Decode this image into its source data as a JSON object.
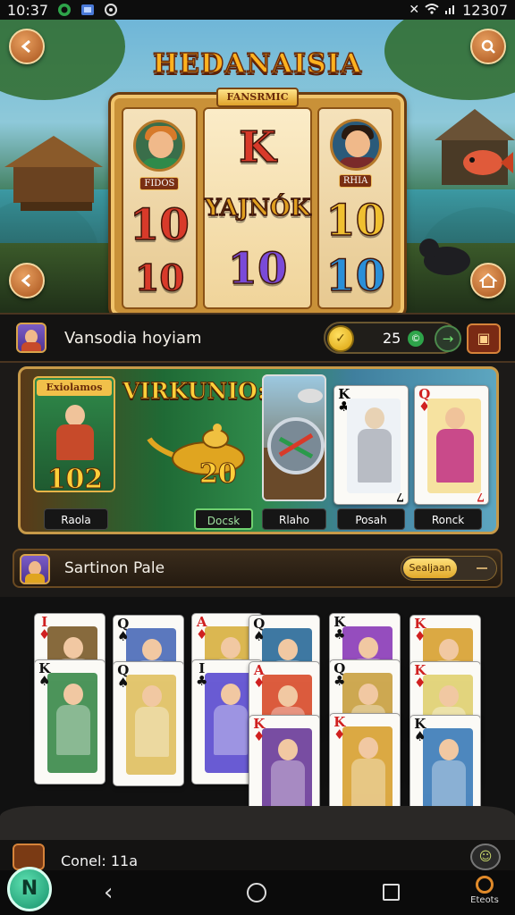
{
  "status_bar": {
    "time": "10:37",
    "clock_right": "12307"
  },
  "game": {
    "title": "HEDANAISIA",
    "reel_banner": "FANSRMIC",
    "reel_tag": "FIDOS",
    "reel_tag_right": "RHIA",
    "reels": [
      [
        "portrait",
        "10",
        "10"
      ],
      [
        "K",
        "YAJNÓK",
        "10"
      ],
      [
        "portrait",
        "10",
        "10"
      ]
    ],
    "reel_colors": [
      "#d83a2a",
      "#e0a020",
      "#2a8fd8",
      "#7a4ad8",
      "#f0c030"
    ]
  },
  "player": {
    "name": "Vansodia hoyiam",
    "balance": "25"
  },
  "feature": {
    "left_header": "Exiolamos",
    "left_value": "102",
    "title": "VIRKUNIO:A",
    "value": "20",
    "labels": [
      "Raola",
      "Docsk",
      "Rlaho",
      "Posah",
      "Ronck"
    ],
    "cards": [
      {
        "rank": "K",
        "suit": "♣",
        "suit_color": "#111111",
        "bottom": "7"
      },
      {
        "rank": "Q",
        "suit": "♦",
        "suit_color": "#d02020",
        "bottom": "7"
      }
    ]
  },
  "collection": {
    "name": "Sartinon Pale",
    "sort_label": "Sealjaan"
  },
  "grid_cards": [
    {
      "rank": "I",
      "suit": "♦",
      "color": "#d02020"
    },
    {
      "rank": "Q",
      "suit": "♠",
      "color": "#111111"
    },
    {
      "rank": "A",
      "suit": "♦",
      "color": "#d02020"
    },
    {
      "rank": "Q",
      "suit": "♠",
      "color": "#111111"
    },
    {
      "rank": "K",
      "suit": "♣",
      "color": "#111111"
    },
    {
      "rank": "K",
      "suit": "♦",
      "color": "#d02020"
    },
    {
      "rank": "Q",
      "suit": "♠",
      "color": "#111111"
    },
    {
      "rank": "K",
      "suit": "♠",
      "color": "#111111"
    },
    {
      "rank": "I",
      "suit": "♣",
      "color": "#111111"
    },
    {
      "rank": "A",
      "suit": "♦",
      "color": "#d02020"
    },
    {
      "rank": "Q",
      "suit": "♣",
      "color": "#111111"
    },
    {
      "rank": "K",
      "suit": "♦",
      "color": "#d02020"
    },
    {
      "rank": "K",
      "suit": "♦",
      "color": "#d02020"
    },
    {
      "rank": "K",
      "suit": "♦",
      "color": "#d02020"
    },
    {
      "rank": "K",
      "suit": "♠",
      "color": "#111111"
    }
  ],
  "info_row": {
    "text": "Conel: 11a"
  },
  "navbar": {
    "right_label": "Eteots"
  },
  "colors": {
    "accent_gold": "#ffcf3a",
    "frame_brown": "#6a4a22",
    "positive_green": "#2ea44a"
  }
}
